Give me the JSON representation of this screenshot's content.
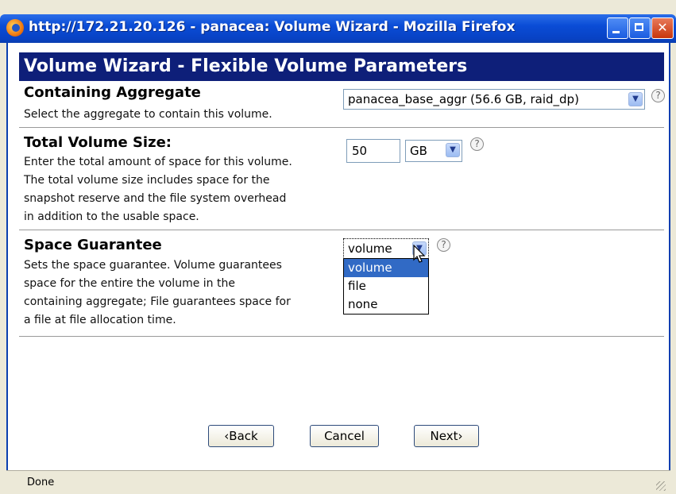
{
  "window": {
    "title": "http://172.21.20.126 - panacea: Volume Wizard - Mozilla Firefox"
  },
  "page": {
    "heading": "Volume Wizard - Flexible Volume Parameters",
    "aggregate": {
      "label": "Containing Aggregate",
      "description": "Select the aggregate to contain this volume.",
      "value": "panacea_base_aggr (56.6 GB, raid_dp)"
    },
    "size": {
      "label": "Total Volume Size:",
      "description": [
        "Enter the total amount of space for this volume.",
        "The total volume size includes space for the",
        "snapshot reserve and the file system overhead",
        "in addition to the usable space."
      ],
      "value": "50",
      "unit": "GB"
    },
    "guarantee": {
      "label": "Space Guarantee",
      "description": [
        "Sets the space guarantee. Volume guarantees",
        "space for the entire the volume in the",
        "containing aggregate; File guarantees space for",
        "a file at file allocation time."
      ],
      "value": "volume",
      "options": [
        "volume",
        "file",
        "none"
      ],
      "highlighted": "volume"
    },
    "help_glyph": "?",
    "buttons": {
      "back": "Back",
      "cancel": "Cancel",
      "next": "Next"
    }
  },
  "status": {
    "text": "Done"
  },
  "colors": {
    "header_bg": "#0e1f79",
    "titlebar": "#0a4cd6",
    "selection": "#316ac5"
  },
  "icons": [
    "firefox-icon",
    "minimize-icon",
    "maximize-icon",
    "close-icon",
    "help-icon",
    "chevron-down-icon",
    "mouse-cursor-icon",
    "chevron-left-icon",
    "chevron-right-icon"
  ]
}
